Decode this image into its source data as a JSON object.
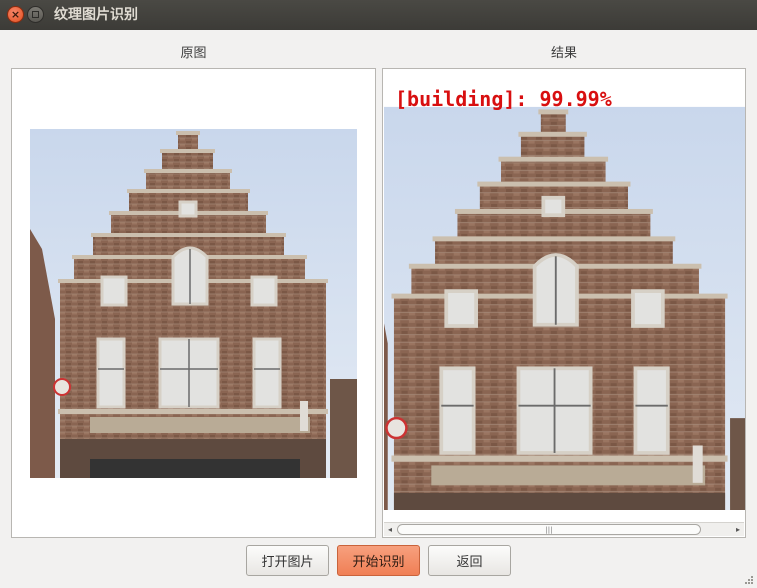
{
  "window": {
    "title": "纹理图片识别",
    "close_glyph": "×"
  },
  "labels": {
    "original": "原图",
    "result": "结果"
  },
  "result": {
    "text": "[building]: 99.99%"
  },
  "scrollbar": {
    "left_arrow": "◂",
    "right_arrow": "▸",
    "thumb_grip": "|||"
  },
  "buttons": {
    "open": "打开图片",
    "start": "开始识别",
    "back": "返回"
  },
  "colors": {
    "accent_button": "#f0855c",
    "result_text": "#d80f10",
    "titlebar": "#3c3b37"
  }
}
